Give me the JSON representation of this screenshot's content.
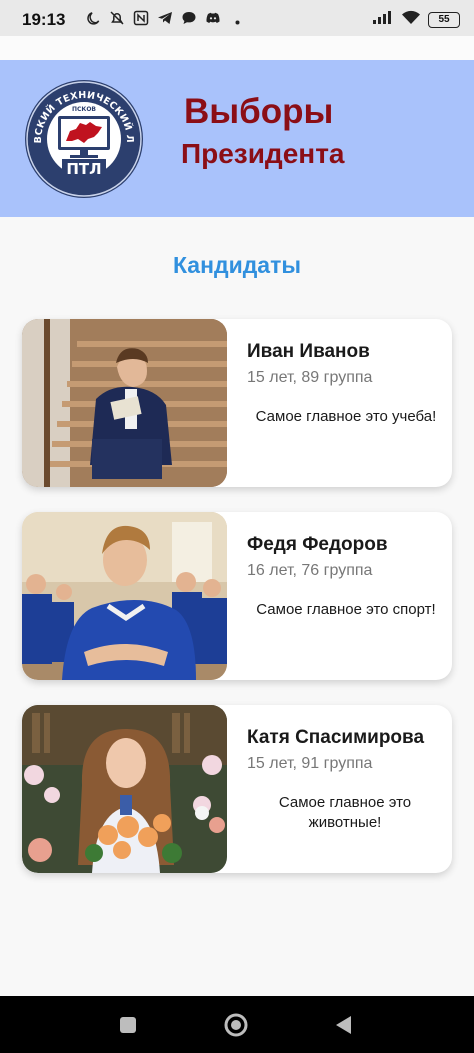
{
  "status_bar": {
    "time": "19:13",
    "battery": "55",
    "left_icons": [
      "moon-icon",
      "bell-off-icon",
      "nfc-icon",
      "telegram-icon",
      "chat-bubble-icon",
      "discord-icon",
      "dot-icon"
    ],
    "right_icons": [
      "signal-icon",
      "wifi-icon",
      "battery-icon"
    ]
  },
  "header": {
    "title_line1": "Выборы",
    "title_line2": "Президента",
    "logo": {
      "arc_text": "ПСКОВСКИЙ ТЕХНИЧЕСКИЙ ЛИЦЕЙ",
      "city": "ПСКОВ",
      "abbr": "ПТЛ"
    },
    "bg_color": "#a9c2fb",
    "title_color": "#8b0e16"
  },
  "section_title": "Кандидаты",
  "candidates": [
    {
      "name": "Иван Иванов",
      "meta": "15 лет, 89 группа",
      "slogan": "Самое главное это учеба!"
    },
    {
      "name": "Федя Федоров",
      "meta": "16 лет, 76 группа",
      "slogan": "Самое главное это спорт!"
    },
    {
      "name": "Катя Спасимирова",
      "meta": "15 лет, 91 группа",
      "slogan": "Самое главное это животные!"
    }
  ],
  "nav_bar": {
    "buttons": [
      "recents-button",
      "home-button",
      "back-button"
    ]
  }
}
